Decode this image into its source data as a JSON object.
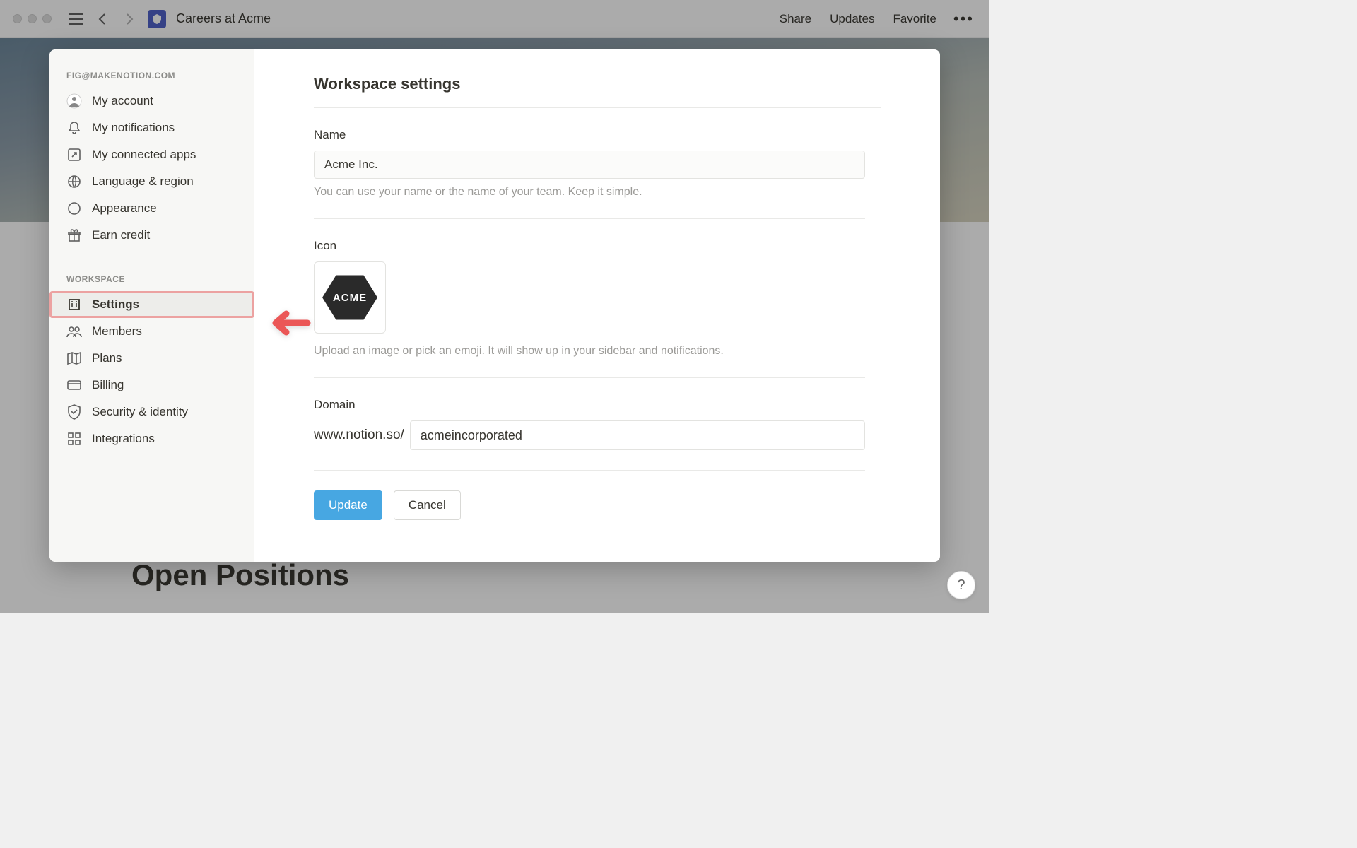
{
  "toolbar": {
    "page_title": "Careers at Acme",
    "share": "Share",
    "updates": "Updates",
    "favorite": "Favorite"
  },
  "background": {
    "heading": "Open Positions"
  },
  "sidebar": {
    "account_header": "FIG@MAKENOTION.COM",
    "workspace_header": "WORKSPACE",
    "items": {
      "my_account": "My account",
      "my_notifications": "My notifications",
      "my_connected_apps": "My connected apps",
      "language_region": "Language & region",
      "appearance": "Appearance",
      "earn_credit": "Earn credit",
      "settings": "Settings",
      "members": "Members",
      "plans": "Plans",
      "billing": "Billing",
      "security": "Security & identity",
      "integrations": "Integrations"
    }
  },
  "settings": {
    "title": "Workspace settings",
    "name": {
      "label": "Name",
      "value": "Acme Inc.",
      "help": "You can use your name or the name of your team. Keep it simple."
    },
    "icon": {
      "label": "Icon",
      "text": "ACME",
      "help": "Upload an image or pick an emoji. It will show up in your sidebar and notifications."
    },
    "domain": {
      "label": "Domain",
      "prefix": "www.notion.so/",
      "value": "acmeincorporated"
    },
    "buttons": {
      "update": "Update",
      "cancel": "Cancel"
    }
  },
  "help": "?"
}
